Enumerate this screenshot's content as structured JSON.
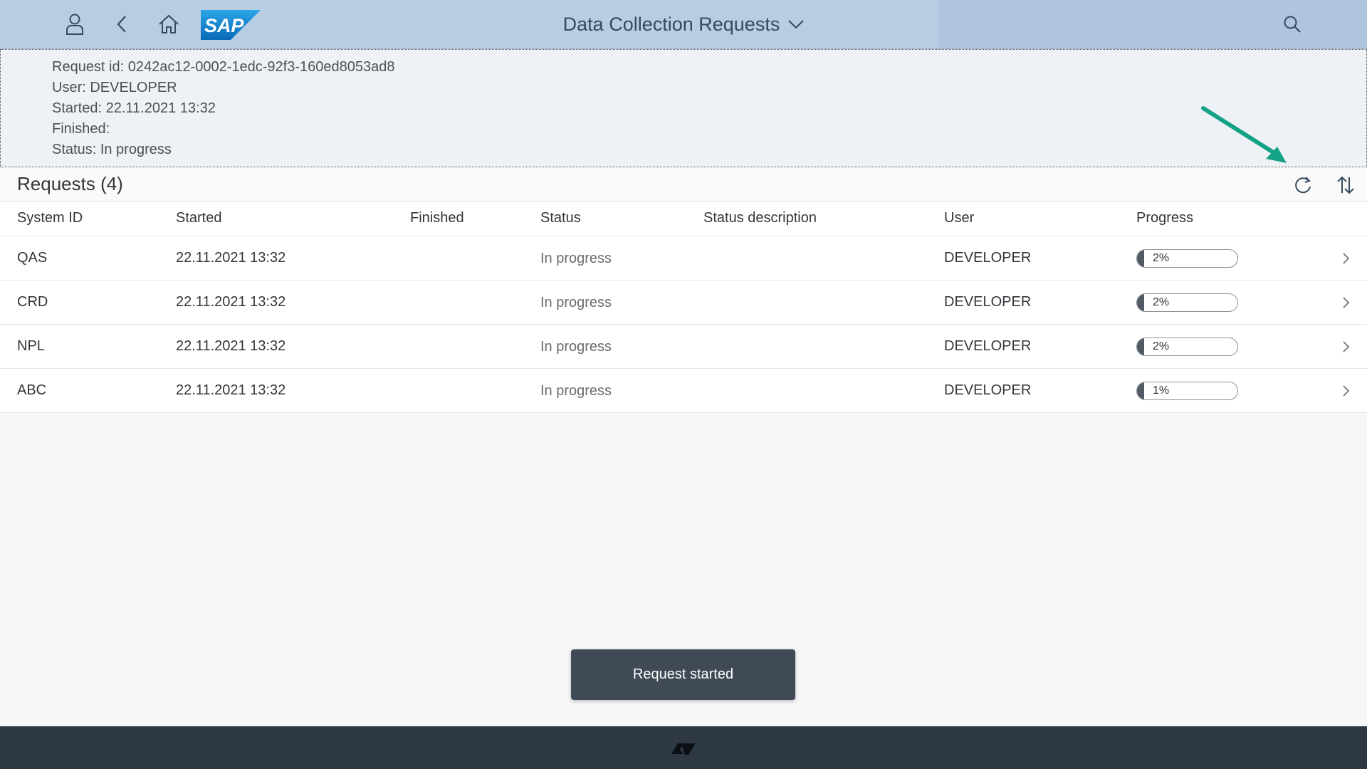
{
  "shell": {
    "title": "Data Collection Requests",
    "icons": [
      "user-icon",
      "back-icon",
      "home-icon",
      "sap-logo",
      "chevron-down-icon",
      "search-icon"
    ],
    "logo_text": "SAP"
  },
  "header": {
    "request_id": "Request id: 0242ac12-0002-1edc-92f3-160ed8053ad8",
    "user": "User: DEVELOPER",
    "started": "Started: 22.11.2021 13:32",
    "finished": "Finished:",
    "status": "Status: In progress"
  },
  "table": {
    "title": "Requests (4)",
    "columns": [
      "System ID",
      "Started",
      "Finished",
      "Status",
      "Status description",
      "User",
      "Progress"
    ],
    "rows": [
      {
        "system_id": "QAS",
        "started": "22.11.2021 13:32",
        "finished": "",
        "status": "In progress",
        "status_description": "",
        "user": "DEVELOPER",
        "progress": 2,
        "progress_label": "2%"
      },
      {
        "system_id": "CRD",
        "started": "22.11.2021 13:32",
        "finished": "",
        "status": "In progress",
        "status_description": "",
        "user": "DEVELOPER",
        "progress": 2,
        "progress_label": "2%"
      },
      {
        "system_id": "NPL",
        "started": "22.11.2021 13:32",
        "finished": "",
        "status": "In progress",
        "status_description": "",
        "user": "DEVELOPER",
        "progress": 2,
        "progress_label": "2%"
      },
      {
        "system_id": "ABC",
        "started": "22.11.2021 13:32",
        "finished": "",
        "status": "In progress",
        "status_description": "",
        "user": "DEVELOPER",
        "progress": 1,
        "progress_label": "1%"
      }
    ]
  },
  "toast": {
    "message": "Request started"
  },
  "colors": {
    "shell_bg": "#b7cde4",
    "header_bg": "#eef2f6",
    "annotation_arrow": "#14a386",
    "progress_fill": "#515a63",
    "toast_bg": "#3f4a56",
    "footer_bg": "#2d3842"
  }
}
